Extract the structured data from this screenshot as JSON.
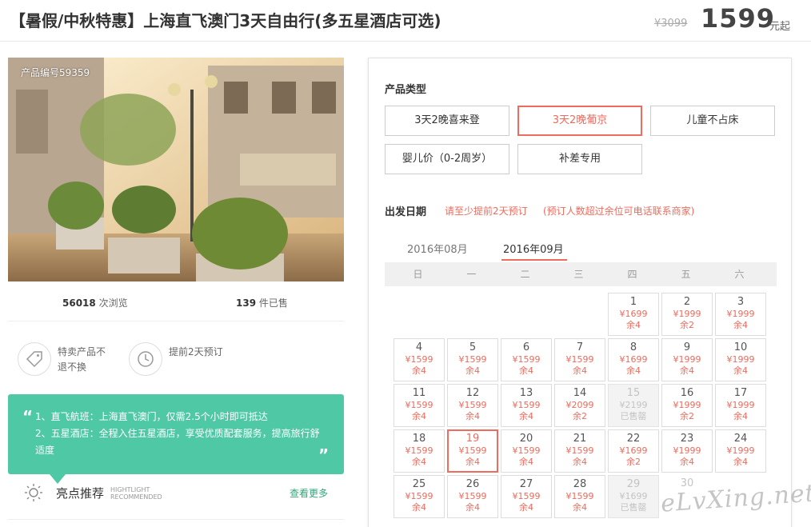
{
  "header": {
    "title": "【暑假/中秋特惠】上海直飞澳门3天自由行(多五星酒店可选)",
    "original_price": "¥3099",
    "price": "1599",
    "price_unit": "元起"
  },
  "photo": {
    "product_id": "产品编号59359"
  },
  "stats": {
    "views_count": "56018",
    "views_label": "次浏览",
    "sold_count": "139",
    "sold_label": "件已售"
  },
  "policies": [
    {
      "icon": "tag-icon",
      "text": "特卖产品不退不换"
    },
    {
      "icon": "clock-icon",
      "text": "提前2天预订"
    }
  ],
  "highlight": {
    "line1": "1、直飞航班：上海直飞澳门，仅需2.5个小时即可抵达",
    "line2": "2、五星酒店：全程入住五星酒店，享受优质配套服务，提高旅行舒适度"
  },
  "recommended": {
    "label": "亮点推荐",
    "label_en_1": "HIGHTLIGHT",
    "label_en_2": "RECOMMENDED",
    "more": "查看更多"
  },
  "booking": {
    "type_label": "产品类型",
    "types": [
      "3天2晚喜来登",
      "3天2晚葡京",
      "儿童不占床",
      "婴儿价（0-2周岁）",
      "补差专用"
    ],
    "selected_type": "3天2晚葡京",
    "date_label": "出发日期",
    "note1": "请至少提前2天预订",
    "note2": "(预订人数超过余位可电话联系商家)",
    "months": [
      "2016年08月",
      "2016年09月"
    ],
    "active_month": "2016年09月",
    "weekdays": [
      "日",
      "一",
      "二",
      "三",
      "四",
      "五",
      "六"
    ],
    "selected_day": "19",
    "days": [
      {
        "d": "1",
        "p": "¥1699",
        "s": "余4"
      },
      {
        "d": "2",
        "p": "¥1999",
        "s": "余2"
      },
      {
        "d": "3",
        "p": "¥1999",
        "s": "余4"
      },
      {
        "d": "4",
        "p": "¥1599",
        "s": "余4"
      },
      {
        "d": "5",
        "p": "¥1599",
        "s": "余4"
      },
      {
        "d": "6",
        "p": "¥1599",
        "s": "余4"
      },
      {
        "d": "7",
        "p": "¥1599",
        "s": "余4"
      },
      {
        "d": "8",
        "p": "¥1699",
        "s": "余4"
      },
      {
        "d": "9",
        "p": "¥1999",
        "s": "余4"
      },
      {
        "d": "10",
        "p": "¥1999",
        "s": "余4"
      },
      {
        "d": "11",
        "p": "¥1599",
        "s": "余4"
      },
      {
        "d": "12",
        "p": "¥1599",
        "s": "余4"
      },
      {
        "d": "13",
        "p": "¥1599",
        "s": "余4"
      },
      {
        "d": "14",
        "p": "¥2099",
        "s": "余2"
      },
      {
        "d": "15",
        "p": "¥2199",
        "s": "已售罄",
        "soldout": true
      },
      {
        "d": "16",
        "p": "¥1999",
        "s": "余2"
      },
      {
        "d": "17",
        "p": "¥1999",
        "s": "余4"
      },
      {
        "d": "18",
        "p": "¥1599",
        "s": "余4"
      },
      {
        "d": "19",
        "p": "¥1599",
        "s": "余4"
      },
      {
        "d": "20",
        "p": "¥1599",
        "s": "余4"
      },
      {
        "d": "21",
        "p": "¥1599",
        "s": "余4"
      },
      {
        "d": "22",
        "p": "¥1699",
        "s": "余2"
      },
      {
        "d": "23",
        "p": "¥1999",
        "s": "余4"
      },
      {
        "d": "24",
        "p": "¥1999",
        "s": "余4"
      },
      {
        "d": "25",
        "p": "¥1599",
        "s": "余4"
      },
      {
        "d": "26",
        "p": "¥1599",
        "s": "余4"
      },
      {
        "d": "27",
        "p": "¥1599",
        "s": "余4"
      },
      {
        "d": "28",
        "p": "¥1599",
        "s": "余4"
      },
      {
        "d": "29",
        "p": "¥1699",
        "s": "已售罄",
        "soldout": true
      },
      {
        "d": "30",
        "p": "",
        "s": "",
        "plain": true
      }
    ]
  },
  "watermark": "eLvXing.net",
  "colors": {
    "accent": "#ee6b5d",
    "highlight_bg": "#4fc8a5",
    "more_link": "#2fa67a"
  }
}
